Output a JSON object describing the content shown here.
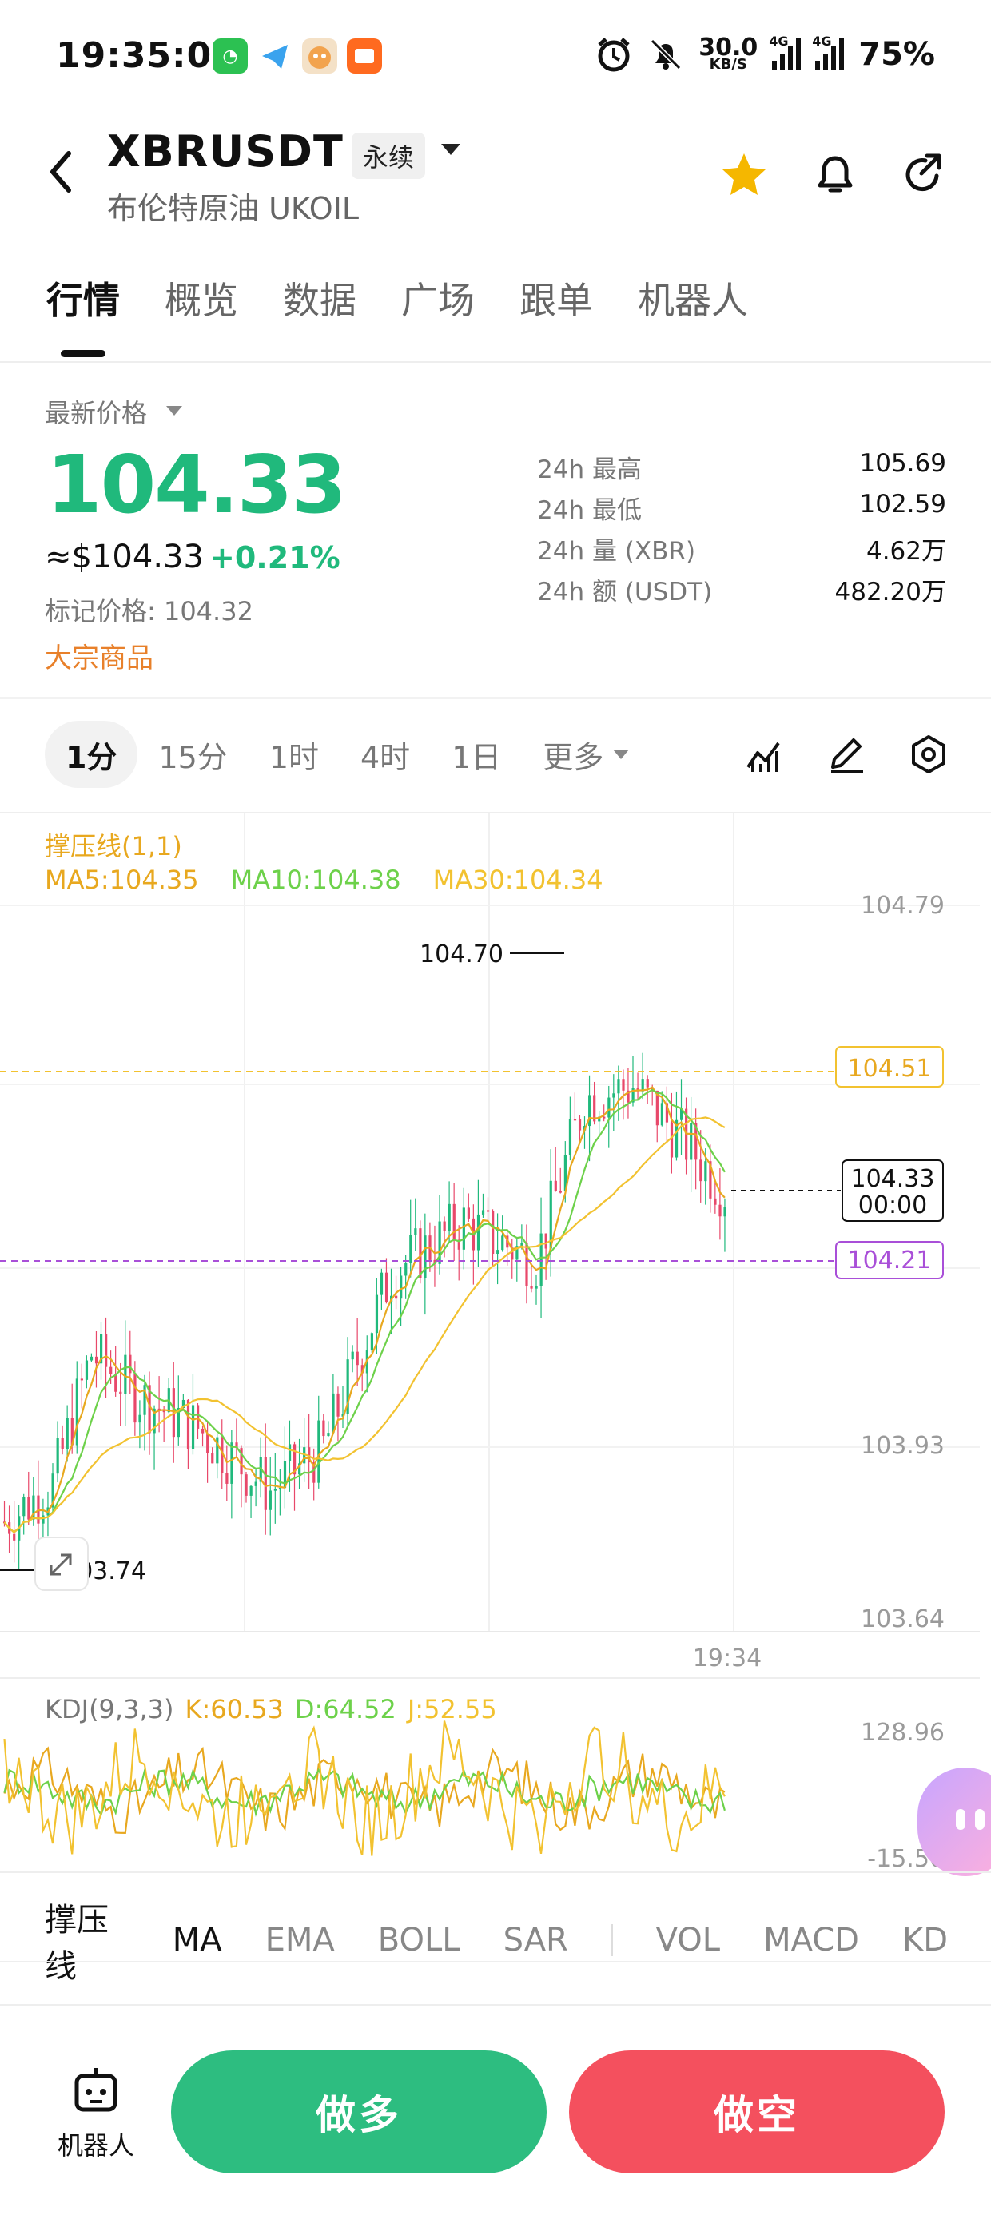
{
  "status_bar": {
    "time": "19:35:00",
    "net_speed": "30.0",
    "net_unit": "KB/S",
    "network_1": "4G",
    "network_2": "4G",
    "battery": "75%"
  },
  "header": {
    "symbol": "XBRUSDT",
    "contract_type": "永续",
    "subtitle": "布伦特原油 UKOIL",
    "favorite_color": "#f5b700"
  },
  "tabs": [
    "行情",
    "概览",
    "数据",
    "广场",
    "跟单",
    "机器人"
  ],
  "price": {
    "label": "最新价格",
    "last": "104.33",
    "usd": "≈$104.33",
    "change": "+0.21%",
    "mark": "标记价格: 104.32",
    "category": "大宗商品",
    "up_color": "#20b97c"
  },
  "stats": [
    {
      "label": "24h  最高",
      "value": "105.69"
    },
    {
      "label": "24h  最低",
      "value": "102.59"
    },
    {
      "label": "24h  量 (XBR)",
      "value": "4.62万"
    },
    {
      "label": "24h  额 (USDT)",
      "value": "482.20万"
    }
  ],
  "intervals": [
    "1分",
    "15分",
    "1时",
    "4时",
    "1日"
  ],
  "more_label": "更多",
  "chart_overlay": {
    "sr_label": "撑压线(1,1)",
    "ma5": "MA5:104.35",
    "ma10": "MA10:104.38",
    "ma30": "MA30:104.34",
    "kdj_label": "KDJ(9,3,3)",
    "k": "K:60.53",
    "d": "D:64.52",
    "j": "J:52.55"
  },
  "chart_labels": {
    "y_top": "104.79",
    "y_mid": "103.93",
    "y_bottom": "103.64",
    "high_mark": "104.70",
    "low_mark": "103.74",
    "resistance": "104.51",
    "support": "104.21",
    "current_price": "104.33",
    "countdown": "00:00",
    "time_tick": "19:34",
    "kdj_top": "128.96",
    "kdj_bottom": "-15.50"
  },
  "chart_data": {
    "type": "candlestick",
    "x_label_shown": "19:34",
    "ylim": [
      103.64,
      104.79
    ],
    "high": 104.7,
    "low": 103.74,
    "last": 104.33,
    "resistance_line": 104.51,
    "support_line": 104.21,
    "ma": {
      "MA5": 104.35,
      "MA10": 104.38,
      "MA30": 104.34
    },
    "kdj": {
      "K": 60.53,
      "D": 64.52,
      "J": 52.55,
      "range": [
        -15.5,
        128.96
      ]
    },
    "colors": {
      "up": "#20b97c",
      "down": "#e8486a",
      "ma5": "#e8a81f",
      "ma10": "#6dd14a",
      "ma30": "#f2c230",
      "resistance": "#f2c230",
      "support": "#a94fd8"
    }
  },
  "indicators": [
    "撑压线",
    "MA",
    "EMA",
    "BOLL",
    "SAR",
    "VOL",
    "MACD",
    "KD"
  ],
  "actions": {
    "robot": "机器人",
    "long": "做多",
    "short": "做空"
  }
}
